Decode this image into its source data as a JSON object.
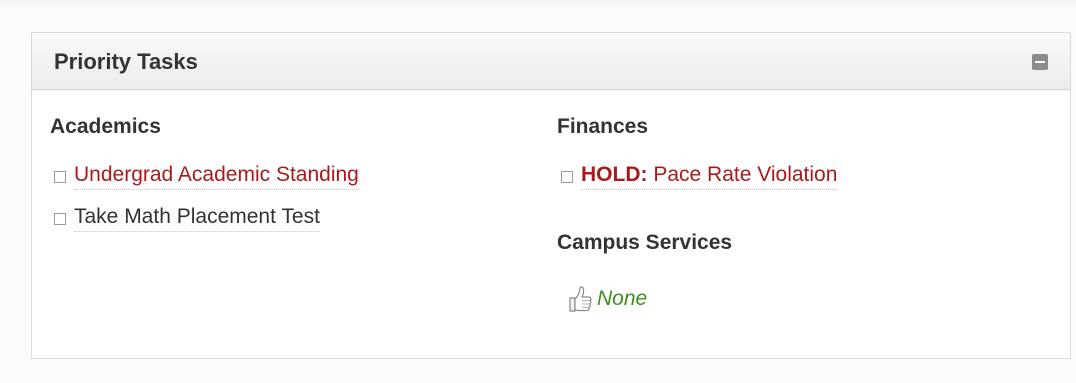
{
  "panel": {
    "title": "Priority Tasks",
    "collapse_icon": "collapse-minus-icon"
  },
  "academics": {
    "heading": "Academics",
    "tasks": [
      {
        "label": "Undergrad Academic Standing",
        "color": "#a91b1b"
      },
      {
        "label": "Take Math Placement Test",
        "color": "#333333"
      }
    ]
  },
  "finances": {
    "heading": "Finances",
    "tasks": [
      {
        "prefix": "HOLD:",
        "label": " Pace Rate Violation",
        "color": "#a91b1b"
      }
    ]
  },
  "campus_services": {
    "heading": "Campus Services",
    "status_icon": "thumbs-up-icon",
    "status_text": "None",
    "status_color": "#3d8f1d"
  }
}
